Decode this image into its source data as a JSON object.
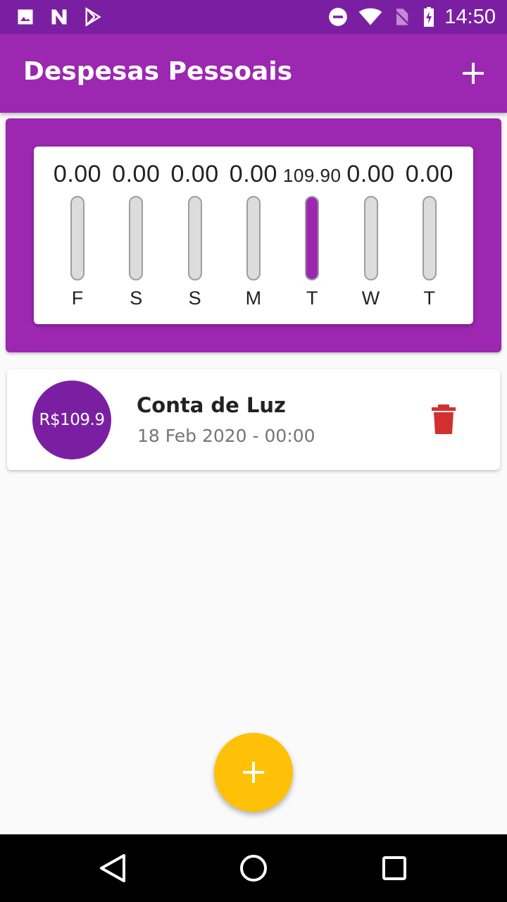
{
  "status_bar": {
    "time": "14:50",
    "left_icons": [
      "image-icon",
      "notification-n-icon",
      "play-store-icon"
    ],
    "right_icons": [
      "do-not-disturb-icon",
      "wifi-icon",
      "no-sim-icon",
      "battery-charging-icon"
    ]
  },
  "app_bar": {
    "title": "Despesas Pessoais",
    "add_icon": "plus-icon"
  },
  "chart_data": {
    "type": "bar",
    "categories": [
      "F",
      "S",
      "S",
      "M",
      "T",
      "W",
      "T"
    ],
    "values": [
      0.0,
      0.0,
      0.0,
      0.0,
      109.9,
      0.0,
      0.0
    ],
    "value_labels": [
      "0.00",
      "0.00",
      "0.00",
      "0.00",
      "109.90",
      "0.00",
      "0.00"
    ],
    "fill_fractions": [
      0,
      0,
      0,
      0,
      1,
      0,
      0
    ],
    "bar_color": "#9c27b0",
    "track_color": "#dcdcdc",
    "title": "",
    "xlabel": "",
    "ylabel": ""
  },
  "transactions": [
    {
      "amount": "R$109.9",
      "title": "Conta de Luz",
      "date": "18 Feb 2020 - 00:00",
      "delete_icon": "trash-icon"
    }
  ],
  "fab": {
    "icon": "plus-icon",
    "color": "#ffc107"
  },
  "nav_bar": {
    "icons": [
      "back-triangle-icon",
      "home-circle-icon",
      "recents-square-icon"
    ]
  },
  "colors": {
    "primary": "#9c27b0",
    "primary_dark": "#7b1fa2",
    "accent": "#ffc107",
    "delete": "#d32f2f"
  }
}
